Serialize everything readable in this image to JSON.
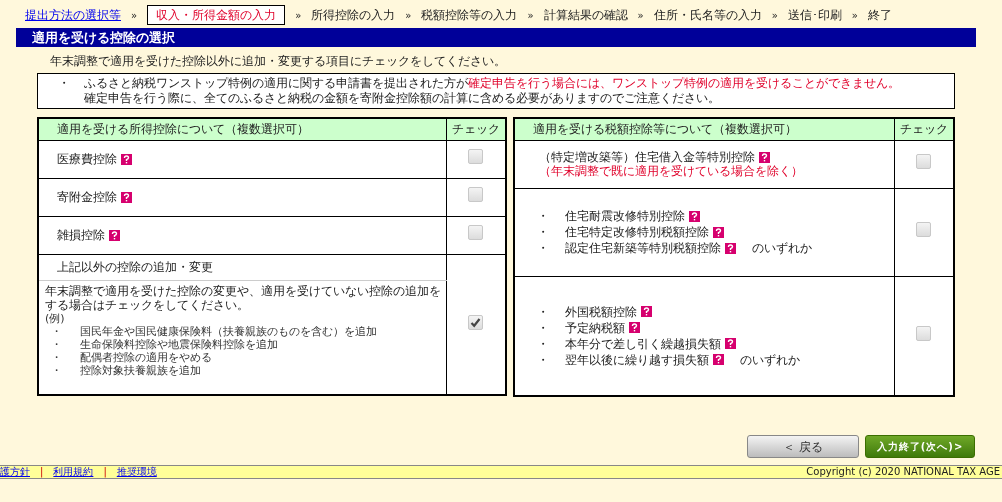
{
  "breadcrumbs": [
    {
      "kind": "link",
      "label": "提出方法の選択等"
    },
    {
      "kind": "separator",
      "label": "»"
    },
    {
      "kind": "current",
      "label": "収入・所得金額の入力"
    },
    {
      "kind": "separator",
      "label": "»"
    },
    {
      "kind": "step",
      "label": "所得控除の入力"
    },
    {
      "kind": "separator",
      "label": "»"
    },
    {
      "kind": "step",
      "label": "税額控除等の入力"
    },
    {
      "kind": "separator",
      "label": "»"
    },
    {
      "kind": "step",
      "label": "計算結果の確認"
    },
    {
      "kind": "separator",
      "label": "»"
    },
    {
      "kind": "step",
      "label": "住所・氏名等の入力"
    },
    {
      "kind": "separator",
      "label": "»"
    },
    {
      "kind": "step",
      "label": "送信･印刷"
    },
    {
      "kind": "separator",
      "label": "»"
    },
    {
      "kind": "step",
      "label": "終了"
    }
  ],
  "page_title": "適用を受ける控除の選択",
  "instruction": "年末調整で適用を受けた控除以外に追加・変更する項目にチェックをしてください。",
  "notice": {
    "bullet": "・",
    "text": "ふるさと納税ワンストップ特例の適用に関する申請書を提出された方が",
    "warning": "確定申告を行う場合には、ワンストップ特例の適用を受けることができません。",
    "text2": "確定申告を行う際に、全てのふるさと納税の金額を寄附金控除額の計算に含める必要がありますのでご注意ください。"
  },
  "income_deductions": {
    "header": "適用を受ける所得控除について（複数選択可）",
    "check_header": "チェック",
    "rows": [
      {
        "kind": "simple",
        "label": "医療費控除",
        "help": true,
        "checked": false
      },
      {
        "kind": "simple",
        "label": "寄附金控除",
        "help": true,
        "checked": false
      },
      {
        "kind": "simple",
        "label": "雑損控除",
        "help": true,
        "checked": false
      },
      {
        "kind": "detail",
        "label": "上記以外の控除の追加・変更",
        "description": "年末調整で適用を受けた控除の変更や、適用を受けていない控除の追加をする場合はチェックをしてください。",
        "example_label": "(例)",
        "examples": [
          "国民年金や国民健康保険料（扶養親族のものを含む）を追加",
          "生命保険料控除や地震保険料控除を追加",
          "配偶者控除の適用をやめる",
          "控除対象扶養親族を追加"
        ],
        "checked": true
      }
    ]
  },
  "tax_credits": {
    "header": "適用を受ける税額控除等について（複数選択可）",
    "check_header": "チェック",
    "rows": [
      {
        "kind": "single",
        "label": "（特定増改築等）住宅借入金等特別控除",
        "help": true,
        "note": "（年末調整で既に適用を受けている場合を除く）",
        "checked": false
      },
      {
        "kind": "list",
        "items": [
          {
            "label": "住宅耐震改修特別控除",
            "help": true
          },
          {
            "label": "住宅特定改修特別税額控除",
            "help": true
          },
          {
            "label": "認定住宅新築等特別税額控除",
            "help": true
          }
        ],
        "suffix": "のいずれか",
        "checked": false
      },
      {
        "kind": "list",
        "items": [
          {
            "label": "外国税額控除",
            "help": true
          },
          {
            "label": "予定納税額",
            "help": true
          },
          {
            "label": "本年分で差し引く繰越損失額",
            "help": true
          },
          {
            "label": "翌年以後に繰り越す損失額",
            "help": true
          }
        ],
        "suffix": "のいずれか",
        "checked": false
      }
    ]
  },
  "buttons": {
    "back": "＜ 戻る",
    "next": "入力終了(次へ)>"
  },
  "footer": {
    "links": [
      "護方針",
      "利用規約",
      "推奨環境"
    ],
    "separator": "|",
    "copyright": "Copyright (c) 2020 NATIONAL TAX AGE"
  }
}
